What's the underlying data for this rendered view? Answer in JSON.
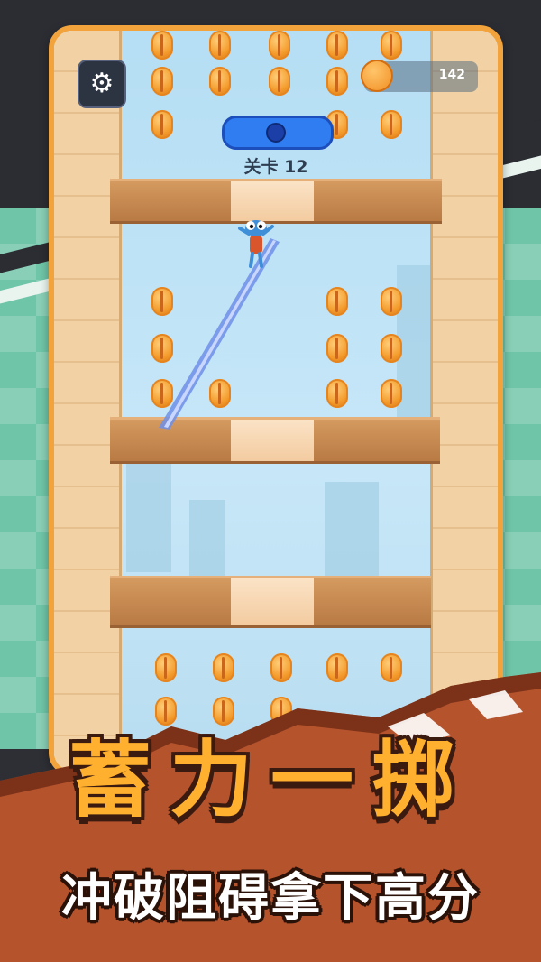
{
  "hud": {
    "settings_icon": "gear-icon",
    "coin_icon": "basketball-coin-icon",
    "coin_count": "142",
    "level_label": "关卡 12"
  },
  "banner": {
    "title": "蓄力一掷",
    "subtitle": "冲破阻碍拿下高分"
  },
  "colors": {
    "accent": "#f3a33b",
    "progress": "#2f7df0",
    "title": "#ffb02e",
    "ground": "#b5532d"
  }
}
